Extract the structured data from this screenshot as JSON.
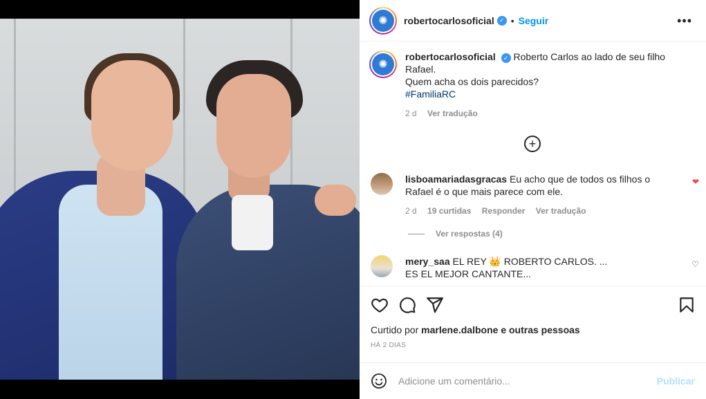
{
  "post": {
    "author": "robertocarlosoficial",
    "follow_label": "Seguir",
    "more_label": "•••",
    "separator": "•"
  },
  "caption": {
    "author": "robertocarlosoficial",
    "text_line1": "Roberto Carlos ao lado de seu filho Rafael.",
    "text_line2": "Quem acha os dois parecidos?",
    "hashtag": "#FamiliaRC",
    "age": "2 d",
    "translate": "Ver tradução"
  },
  "comments": [
    {
      "author": "lisboamariadasgracas",
      "text": "Eu acho que de todos os filhos o Rafael é o que mais parece com ele.",
      "age": "2 d",
      "likes": "19 curtidas",
      "reply": "Responder",
      "translate": "Ver tradução",
      "liked": true
    },
    {
      "author": "mery_saa",
      "text_line1": "EL REY 👑 ROBERTO CARLOS. ...",
      "text_line2": "ES EL MEJOR CANTANTE...",
      "liked": false
    }
  ],
  "replies_label": "Ver respostas (4)",
  "liked_by": {
    "prefix": "Curtido por",
    "user": "marlene.dalbone",
    "suffix": "e outras pessoas"
  },
  "timestamp": "HÁ 2 DIAS",
  "comment_box": {
    "placeholder": "Adicione um comentário...",
    "publish_label": "Publicar"
  },
  "icons": [
    "heart-icon",
    "comment-icon",
    "share-icon",
    "bookmark-icon",
    "emoji-icon",
    "plus-circle-icon",
    "verified-icon",
    "more-icon"
  ],
  "colors": {
    "link": "#0095f6",
    "liked": "#ed4956",
    "publish_disabled": "#b2dffc",
    "hashtag": "#00376b"
  }
}
